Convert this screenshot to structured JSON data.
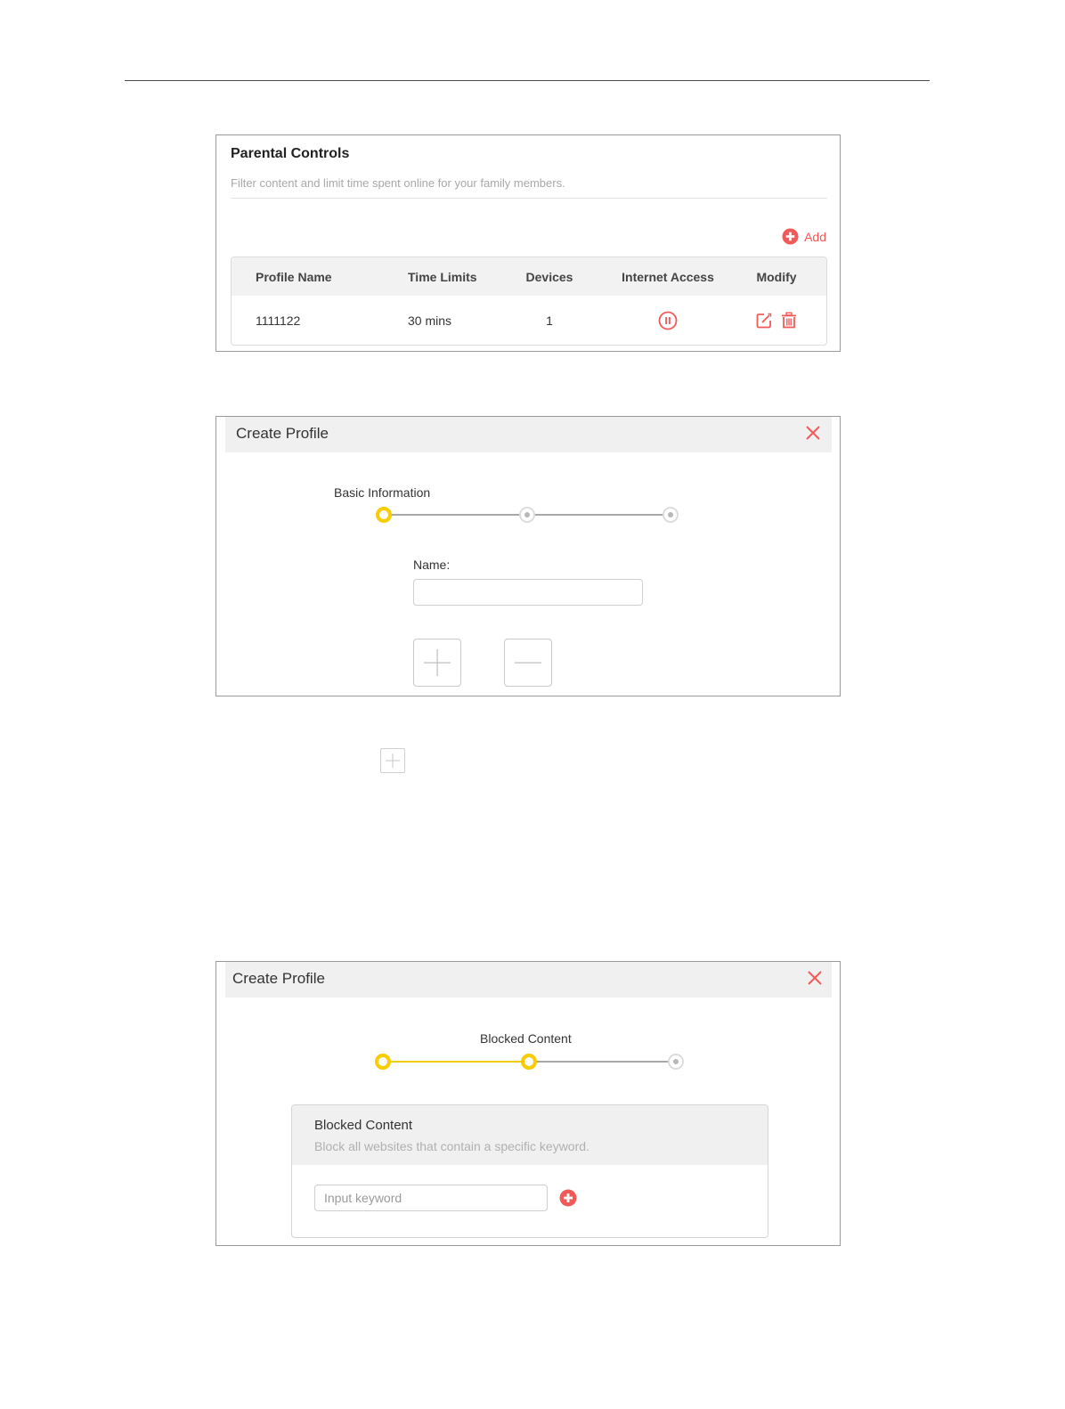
{
  "colors": {
    "accent": "#f25a5a",
    "step_active": "#f7cc00",
    "step_idle": "#b8b8b8",
    "header_bg": "#f0f0f0"
  },
  "parental_controls": {
    "title": "Parental Controls",
    "subtitle": "Filter content and limit time spent online for your family members.",
    "add_label": "Add",
    "add_icon": "plus-circle-icon",
    "table": {
      "headers": [
        "Profile Name",
        "Time Limits",
        "Devices",
        "Internet Access",
        "Modify"
      ],
      "rows": [
        {
          "profile_name": "1111122",
          "time_limits": "30 mins",
          "devices": "1",
          "internet_access_icon": "pause-circle-icon",
          "modify_icons": [
            "edit-icon",
            "trash-icon"
          ]
        }
      ]
    }
  },
  "create_profile_step1": {
    "title": "Create Profile",
    "close_icon": "close-icon",
    "step_label": "Basic Information",
    "current_step": 1,
    "total_steps": 3,
    "name_label": "Name:",
    "name_value": "",
    "buttons": [
      "plus-icon",
      "minus-icon"
    ]
  },
  "inline_plus_icon": "plus-icon",
  "create_profile_step2": {
    "title": "Create Profile",
    "close_icon": "close-icon",
    "step_label": "Blocked Content",
    "current_step": 2,
    "total_steps": 3,
    "blocked_content": {
      "title": "Blocked Content",
      "description": "Block all websites that contain a specific keyword.",
      "input_placeholder": "Input keyword",
      "input_value": "",
      "add_icon": "plus-circle-icon"
    }
  }
}
